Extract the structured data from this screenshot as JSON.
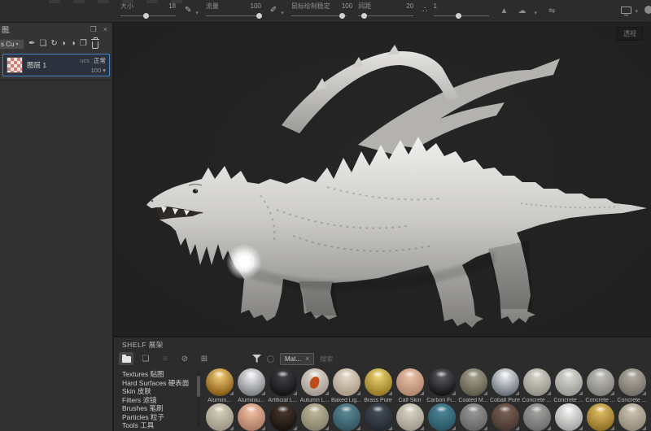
{
  "icons": {
    "brush": "✎",
    "pencil": "✐",
    "scatter": "∴",
    "chevron": "▾",
    "triangle": "▲",
    "cloud": "☁",
    "symmetry": "⇋",
    "pen": "✒",
    "add_layer": "❏",
    "effect": "↻",
    "fill": "◗",
    "smart": "◑",
    "folder_add": "❐",
    "popout": "❐",
    "close": "×",
    "page": "❏",
    "list": "≡",
    "eye_off": "⊘",
    "import": "⊞",
    "chip_close": "×"
  },
  "top_toolbar": {
    "sliders": [
      {
        "label": "大小",
        "value": "18",
        "pos": "45%",
        "icon": "✎",
        "chev": "▾"
      },
      {
        "label": "流量",
        "value": "100",
        "pos": "96%",
        "icon": "✐",
        "chev": "▾"
      },
      {
        "label": "鼠标绘制稳定",
        "value": "100",
        "pos": "92%",
        "icon": "",
        "chev": ""
      },
      {
        "label": "间距",
        "value": "20",
        "pos": "10%",
        "icon": "∴",
        "chev": ""
      },
      {
        "label": "",
        "value": "1",
        "pos": "45%",
        "icon": "",
        "chev": ""
      }
    ]
  },
  "layers_panel": {
    "title": "图层",
    "dropdown": "s Cu",
    "layer": {
      "name": "图层 1",
      "channels": "ucs",
      "blend": "正常",
      "opacity": "100"
    }
  },
  "viewport": {
    "view_button": "透视"
  },
  "shelf": {
    "title": "SHELF 展架",
    "chip": "Mat...",
    "search_placeholder": "搜索",
    "categories": [
      "Textures 贴图",
      "Hard Surfaces 硬表面",
      "Skin 皮肤",
      "Filters 滤镜",
      "Brushes 笔刷",
      "Particles 粒子",
      "Tools 工具"
    ],
    "materials_row1": [
      {
        "name": "Alumini...",
        "c1": "#f5cf7a",
        "c2": "#7a4c08"
      },
      {
        "name": "Aluminiu...",
        "c1": "#f2f2f4",
        "c2": "#6f7276"
      },
      {
        "name": "Artificial L...",
        "c1": "#44444a",
        "c2": "#0e0e10"
      },
      {
        "name": "Autumn L...",
        "c1": "#e4ddd2",
        "c2": "#99918a",
        "accent": "#c24a14"
      },
      {
        "name": "Baked Lig...",
        "c1": "#e6dccd",
        "c2": "#a3927e"
      },
      {
        "name": "Brass Pure",
        "c1": "#f0d775",
        "c2": "#8a6d1a"
      },
      {
        "name": "Calf Skin",
        "c1": "#ecc3ab",
        "c2": "#a97f66"
      },
      {
        "name": "Carbon Fi...",
        "c1": "#5e5e64",
        "c2": "#0a0a0c"
      },
      {
        "name": "Coated M...",
        "c1": "#a8a494",
        "c2": "#55523f"
      },
      {
        "name": "Cobalt Pure",
        "c1": "#eef0f4",
        "c2": "#585f6a"
      },
      {
        "name": "Concrete ...",
        "c1": "#d9d6cd",
        "c2": "#8b887f"
      },
      {
        "name": "Concrete ...",
        "c1": "#dddcd8",
        "c2": "#93928c"
      },
      {
        "name": "Concrete ...",
        "c1": "#c4c2bc",
        "c2": "#7b7974"
      },
      {
        "name": "Concrete ...",
        "c1": "#b4b0a6",
        "c2": "#6b6760"
      }
    ],
    "materials_row2": [
      {
        "c1": "#d6cfbd",
        "c2": "#968f7d"
      },
      {
        "c1": "#f2c3a6",
        "c2": "#a4705a"
      },
      {
        "c1": "#4a3a30",
        "c2": "#120d0a"
      },
      {
        "c1": "#c2bda0",
        "c2": "#7d7860"
      },
      {
        "c1": "#5d8b98",
        "c2": "#2c4f5a"
      },
      {
        "c1": "#46505a",
        "c2": "#1e242b"
      },
      {
        "c1": "#dcd8c8",
        "c2": "#979283"
      },
      {
        "c1": "#4e879a",
        "c2": "#24505f"
      },
      {
        "c1": "#9a9a9a",
        "c2": "#5f5f5f"
      },
      {
        "c1": "#7c6458",
        "c2": "#42322a"
      },
      {
        "c1": "#a4a4a2",
        "c2": "#666666"
      },
      {
        "c1": "#f4f4f2",
        "c2": "#9a9a98"
      },
      {
        "c1": "#e3c268",
        "c2": "#86651c"
      },
      {
        "c1": "#cfc6b4",
        "c2": "#8a8272"
      }
    ]
  }
}
